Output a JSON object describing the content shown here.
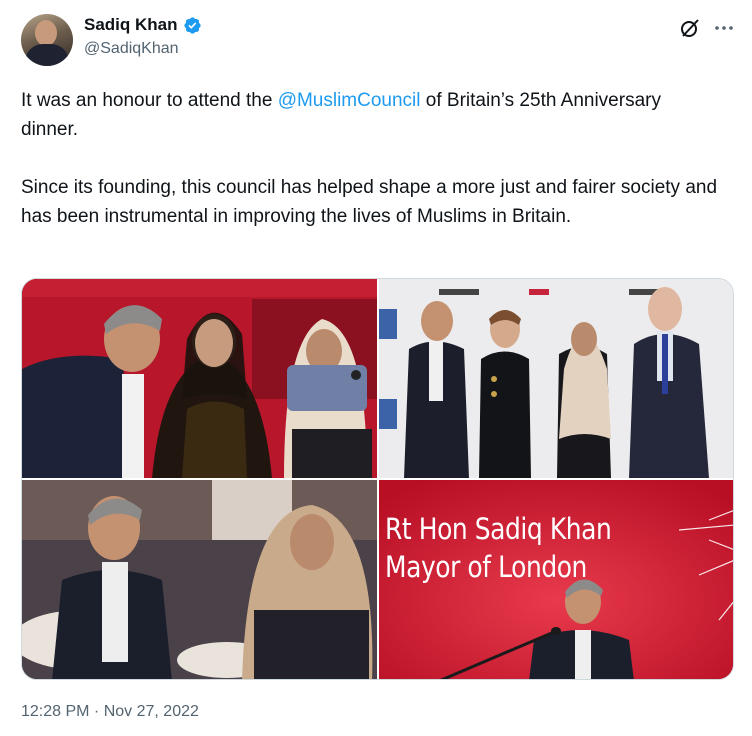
{
  "author": {
    "display_name": "Sadiq Khan",
    "handle": "@SadiqKhan",
    "verified_icon": "verified-badge-icon",
    "verified_color": "#1d9bf0"
  },
  "tweet": {
    "para1_pre": "It was an honour to attend the ",
    "para1_mention": "@MuslimCouncil",
    "para1_post": " of Britain’s 25th Anniversary dinner.",
    "para2": "Since its founding, this council has helped shape a more just and fairer society and has been instrumental in improving the lives of Muslims in Britain."
  },
  "media": {
    "photo4_line1": "Rt Hon Sadiq Khan",
    "photo4_line2": "Mayor of London"
  },
  "meta": {
    "timestamp": "12:28 PM · Nov 27, 2022"
  },
  "colors": {
    "text": "#0f1419",
    "secondary": "#536471",
    "link": "#1d9bf0"
  }
}
